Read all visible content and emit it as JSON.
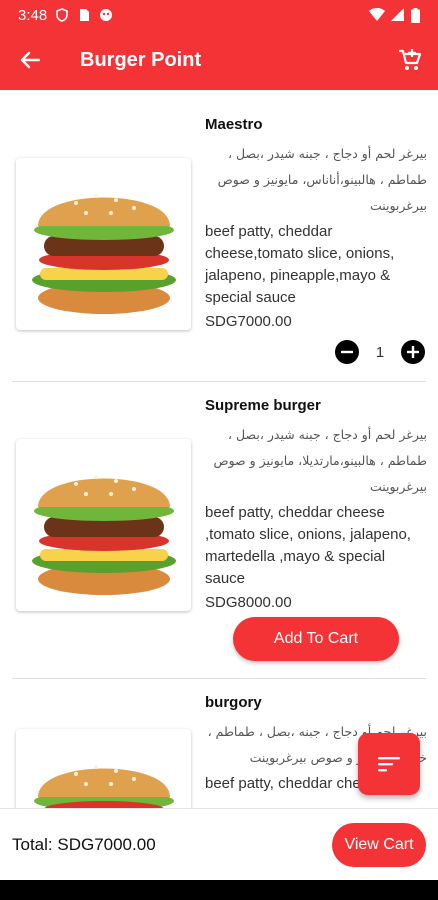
{
  "status_bar": {
    "time": "3:48"
  },
  "app_bar": {
    "title": "Burger Point"
  },
  "items": [
    {
      "name": "Maestro",
      "desc_ar": "بيرغر لحم أو دجاج ، جبنه شيدر ،بصل ، طماطم ، هالبينو،أناناس، مايونيز و صوص بيرغربوينت",
      "desc_en": "beef patty, cheddar cheese,tomato slice, onions, jalapeno, pineapple,mayo & special sauce",
      "price": "SDG7000.00",
      "quantity": "1"
    },
    {
      "name": "Supreme burger",
      "desc_ar": "بيرغر لحم أو دجاج ، جبنه شيدر ،بصل ، طماطم ، هالبينو،مارتديلا، مايونيز و صوص بيرغربوينت",
      "desc_en": "beef patty, cheddar cheese ,tomato slice, onions, jalapeno, martedella ,mayo & special sauce",
      "price": "SDG8000.00",
      "button_label": "Add To Cart"
    },
    {
      "name": "burgory",
      "desc_ar": "بيرغر لحم أو دجاج ، جبنه ،بصل ، طماطم ، خس ، مايونيز و صوص بيرغربوينت",
      "desc_en": "beef patty, cheddar cheese"
    }
  ],
  "bottom_bar": {
    "total": "Total: SDG7000.00",
    "view_cart_label": "View Cart"
  },
  "colors": {
    "primary": "#f43336",
    "text": "#111111"
  },
  "icons": [
    "back-arrow-icon",
    "cart-icon",
    "minus-icon",
    "plus-icon",
    "filter-icon"
  ]
}
